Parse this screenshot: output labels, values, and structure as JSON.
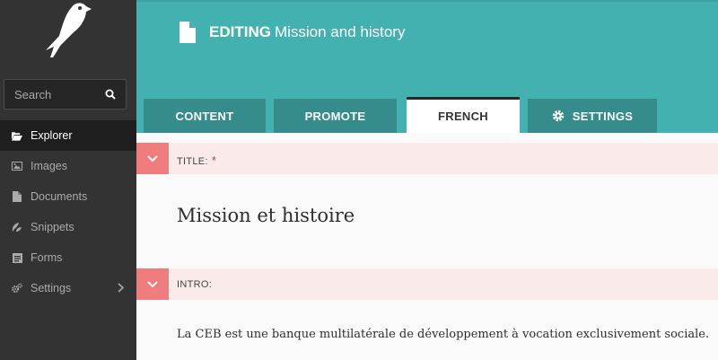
{
  "sidebar": {
    "search": {
      "placeholder": "Search"
    },
    "items": [
      {
        "label": "Explorer",
        "icon": "folder-open-icon"
      },
      {
        "label": "Images",
        "icon": "image-icon"
      },
      {
        "label": "Documents",
        "icon": "document-icon"
      },
      {
        "label": "Snippets",
        "icon": "snippet-icon"
      },
      {
        "label": "Forms",
        "icon": "form-icon"
      },
      {
        "label": "Settings",
        "icon": "cogs-icon"
      }
    ]
  },
  "header": {
    "editing": "EDITING",
    "page_title": "Mission and history"
  },
  "tabs": [
    {
      "label": "CONTENT"
    },
    {
      "label": "PROMOTE"
    },
    {
      "label": "FRENCH",
      "active": true
    },
    {
      "label": "SETTINGS",
      "icon": "gear-icon"
    }
  ],
  "fields": {
    "title": {
      "label": "TITLE:",
      "required": "*",
      "value": "Mission et histoire"
    },
    "intro": {
      "label": "INTRO:",
      "value": "La CEB est une banque multilatérale de développement à vocation exclusivement sociale."
    }
  },
  "colors": {
    "sidebar_bg": "#333333",
    "header_teal": "#43b1b0",
    "tab_teal": "#358c8b",
    "field_accent": "#ef7d7d",
    "field_head_bg": "#fbeaea"
  }
}
